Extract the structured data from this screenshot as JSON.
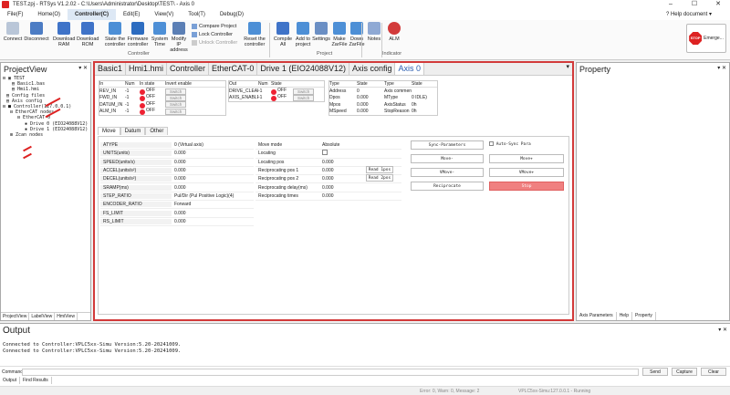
{
  "window": {
    "title": "TEST.zpj - RTSys V1.2.02 - C:\\Users\\Administrator\\Desktop\\TEST\\ - Axis 0"
  },
  "menu": [
    "File(F)",
    "Home(O)",
    "Controller(C)",
    "Edit(E)",
    "View(V)",
    "Tool(T)",
    "Debug(D)"
  ],
  "help": "Help document",
  "ribbon": {
    "buttons": [
      {
        "label": "Connect",
        "color": "#b9c6d8"
      },
      {
        "label": "Disconnect",
        "color": "#4c7cc4"
      },
      {
        "label": "Download RAM",
        "color": "#3f73c8"
      },
      {
        "label": "Download ROM",
        "color": "#3f73c8"
      },
      {
        "label": "State the controller",
        "color": "#4d8fd6"
      },
      {
        "label": "Firmware controller",
        "color": "#2c6cc0"
      },
      {
        "label": "System Time",
        "color": "#4d8fd6"
      },
      {
        "label": "Modify IP address",
        "color": "#5b7fb5"
      },
      {
        "label": "Reset the controller",
        "color": "#4d8fd6"
      },
      {
        "label": "Compile All",
        "color": "#3f73c8"
      },
      {
        "label": "Add to project",
        "color": "#4d8fd6"
      },
      {
        "label": "Settings",
        "color": "#6b8fc4"
      },
      {
        "label": "Make ZarFile",
        "color": "#4d8fd6"
      },
      {
        "label": "Down ZarFile",
        "color": "#4d8fd6"
      },
      {
        "label": "Notes",
        "color": "#8fa9d4"
      },
      {
        "label": "ALM",
        "color": "#d23a3a"
      }
    ],
    "small": [
      "Compare Project",
      "Lock Controller",
      "Unlock Controller"
    ],
    "groups": [
      "Controller",
      "Project",
      "Indicator"
    ],
    "stop": "Emerge..."
  },
  "projectview": {
    "title": "ProjectView",
    "tree": [
      "TEST",
      "Basic1.bas",
      "Hmi1.hmi",
      "Config files",
      "Axis config",
      "Controller(127.0.0.1)",
      "EtherCAT nodes",
      "EtherCAT-0",
      "Drive 0 (EIO24088V12)",
      "Drive 1 (EIO24088V12)",
      "Zcan nodes"
    ],
    "tabs": [
      "ProjectView",
      "LabelView",
      "HmiView"
    ]
  },
  "doctabs": [
    "Basic1",
    "Hmi1.hmi",
    "Controller",
    "EtherCAT-0",
    "Drive 1 (EIO24088V12)",
    "Axis config",
    "Axis 0"
  ],
  "io": {
    "inHeaders": [
      "In",
      "Num",
      "In state",
      "Invert enable"
    ],
    "inRows": [
      {
        "name": "REV_IN",
        "num": "-1",
        "state": "OFF",
        "btn": "Switch"
      },
      {
        "name": "FWD_IN",
        "num": "-1",
        "state": "OFF",
        "btn": "Switch"
      },
      {
        "name": "DATUM_IN",
        "num": "-1",
        "state": "OFF",
        "btn": "Switch"
      },
      {
        "name": "ALM_IN",
        "num": "-1",
        "state": "OFF",
        "btn": "Switch"
      }
    ],
    "outHeaders": [
      "Out",
      "Num",
      "State",
      ""
    ],
    "outRows": [
      {
        "name": "DRIVE_CLEAR",
        "num": "-1",
        "state": "OFF",
        "btn": "Switch"
      },
      {
        "name": "AXIS_ENABLE",
        "num": "-1",
        "state": "OFF",
        "btn": "Switch"
      }
    ],
    "stateHeaders": [
      "Type",
      "State",
      "Type",
      "State"
    ],
    "stateRows": [
      [
        "Address",
        "0",
        "Axis comment",
        ""
      ],
      [
        "Dpos",
        "0.000",
        "MType",
        "0 IDLE)"
      ],
      [
        "Mpos",
        "0.000",
        "AxisStatus",
        "0h"
      ],
      [
        "MSpeed",
        "0.000",
        "StopReason",
        "0h"
      ]
    ]
  },
  "subtabs": [
    "Move",
    "Datum",
    "Other"
  ],
  "params": [
    [
      "ATYPE",
      "0 (Virtual axis)"
    ],
    [
      "UNITS(units)",
      "0.000"
    ],
    [
      "SPEED(units/s)",
      "0.000"
    ],
    [
      "ACCEL(units/s²)",
      "0.000"
    ],
    [
      "DECEL(units/s²)",
      "0.000"
    ],
    [
      "SRAMP(ms)",
      "0.000"
    ],
    [
      "STEP_RATIO",
      "Pul/Dir (Pul Positive Logic)(4)"
    ],
    [
      "ENCODER_RATIO",
      "Forward"
    ],
    [
      "FS_LIMIT",
      "0.000"
    ],
    [
      "RS_LIMIT",
      "0.000"
    ]
  ],
  "move": [
    [
      "Move mode",
      "Absolute"
    ],
    [
      "Locating",
      ""
    ],
    [
      "Locating pos",
      "0.000"
    ],
    [
      "Reciprocating pos 1",
      "0.000"
    ],
    [
      "Reciprocating pos 2",
      "0.000"
    ],
    [
      "Reciprocating delay(ms)",
      "0.000"
    ],
    [
      "Reciprocating times",
      "0.000"
    ]
  ],
  "readpos": [
    "Read 1pos",
    "Read 2pos"
  ],
  "actions": {
    "sync": "Sync-Parameters",
    "auto": "Auto-Sync Para",
    "moveMinus": "Move-",
    "movePlus": "Move+",
    "vmoveMinus": "VMove-",
    "vmovePlus": "VMove+",
    "recip": "Reciprocate",
    "stop": "Stop"
  },
  "property": {
    "title": "Property",
    "tabs": [
      "Axis Parameters",
      "Help",
      "Property"
    ]
  },
  "output": {
    "title": "Output",
    "lines": [
      "Connected to Controller:VPLC5xx-Simu Version:5.20-20241009.",
      "Connected to Controller:VPLC5xx-Simu Version:5.20-20241009."
    ],
    "commandLabel": "Command:",
    "buttons": [
      "Send",
      "Capture",
      "Clear"
    ],
    "tabs": [
      "Output",
      "Find Results"
    ]
  },
  "status": {
    "left": "Error: 0, Warn: 0, Message: 2",
    "right": "VPLC5xx-Simu:127.0.0.1 - Running"
  }
}
